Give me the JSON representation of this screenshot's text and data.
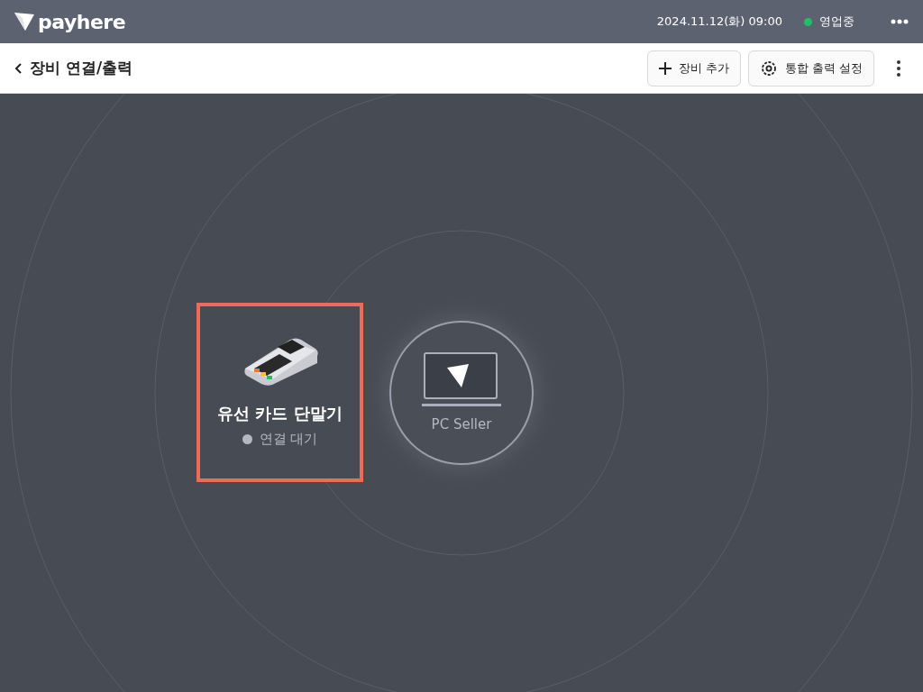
{
  "app": {
    "logo": "payhere",
    "datetime": "2024.11.12(화) 09:00",
    "status": {
      "label": "영업중",
      "color": "#1fbf6a"
    }
  },
  "page": {
    "title": "장비 연결/출력",
    "buttons": [
      {
        "label": "장비 추가",
        "kind": "add"
      },
      {
        "label": "통합 출력 설정",
        "kind": "settings"
      }
    ]
  },
  "devices": [
    {
      "name": "유선 카드 단말기",
      "status": "연결 대기",
      "color": "#b4b8c2",
      "selected": true
    }
  ],
  "hub": {
    "label": "PC Seller"
  }
}
